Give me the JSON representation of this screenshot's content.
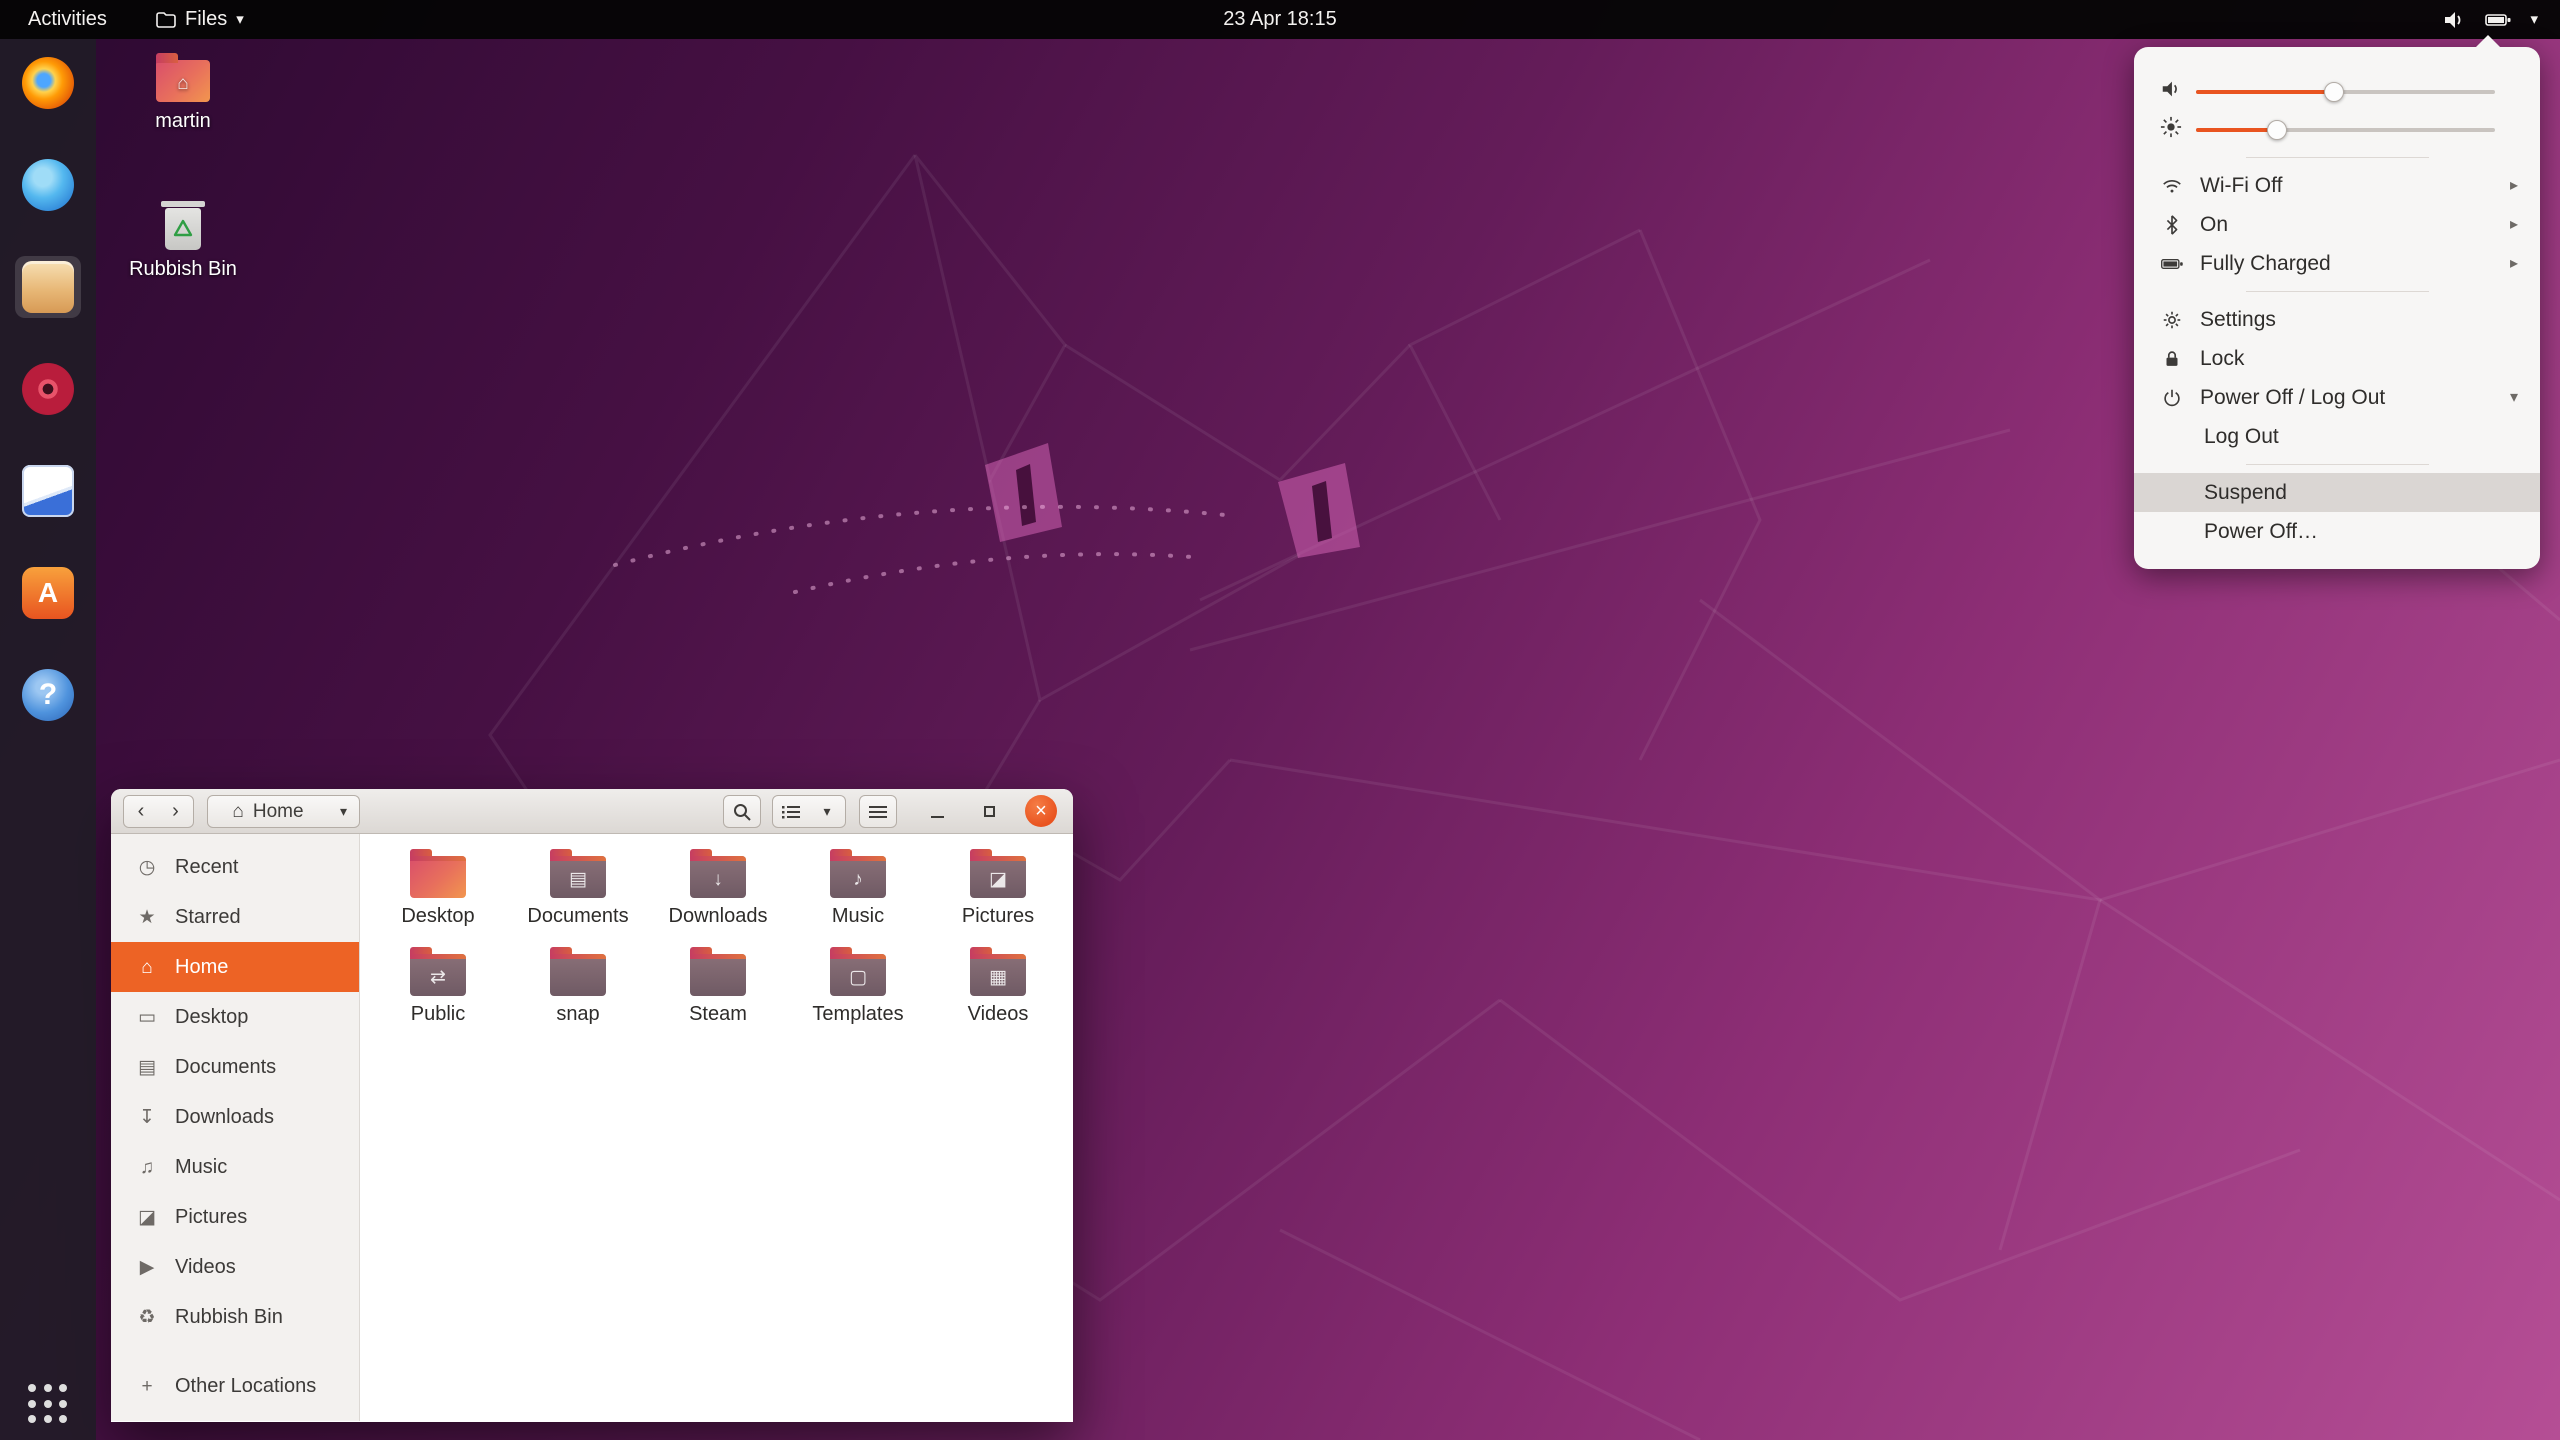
{
  "top_bar": {
    "activities_label": "Activities",
    "app_menu_label": "Files",
    "clock": "23 Apr 18:15"
  },
  "icons": {
    "chevron_down": "▾",
    "chevron_right": "▸",
    "nav_back": "‹",
    "nav_forward": "›",
    "close_glyph": "×",
    "home_glyph": "⌂",
    "plus_glyph": "+",
    "help_glyph": "?",
    "software_glyph": "A"
  },
  "desktop": {
    "icons": [
      {
        "label": "martin"
      },
      {
        "label": "Rubbish Bin"
      }
    ]
  },
  "dock": {
    "items": [
      {
        "name": "firefox"
      },
      {
        "name": "thunderbird"
      },
      {
        "name": "files",
        "active": true
      },
      {
        "name": "rhythmbox"
      },
      {
        "name": "libreoffice-writer"
      },
      {
        "name": "ubuntu-software"
      },
      {
        "name": "help"
      },
      {
        "name": "show-applications"
      }
    ]
  },
  "system_menu": {
    "volume_percent": 46,
    "brightness_percent": 27,
    "items": [
      {
        "label": "Wi-Fi Off",
        "submenu": true
      },
      {
        "label": "On",
        "submenu": true
      },
      {
        "label": "Fully Charged",
        "submenu": true
      },
      {
        "label": "Settings"
      },
      {
        "label": "Lock"
      },
      {
        "label": "Power Off / Log Out",
        "expanded": true
      },
      {
        "label": "Log Out"
      },
      {
        "label": "Suspend",
        "highlighted": true
      },
      {
        "label": "Power Off…"
      }
    ]
  },
  "file_manager": {
    "toolbar": {
      "location": "Home"
    },
    "sidebar": {
      "items": [
        {
          "label": "Recent",
          "icon": "◷"
        },
        {
          "label": "Starred",
          "icon": "★"
        },
        {
          "label": "Home",
          "icon": "⌂",
          "active": true
        },
        {
          "label": "Desktop",
          "icon": "▭"
        },
        {
          "label": "Documents",
          "icon": "▤"
        },
        {
          "label": "Downloads",
          "icon": "↧"
        },
        {
          "label": "Music",
          "icon": "♫"
        },
        {
          "label": "Pictures",
          "icon": "◪"
        },
        {
          "label": "Videos",
          "icon": "▶"
        },
        {
          "label": "Rubbish Bin",
          "icon": "♻"
        },
        {
          "label": "Other Locations",
          "icon": "+"
        }
      ]
    },
    "folders": [
      {
        "label": "Desktop",
        "emblem": "",
        "variant": "gradient"
      },
      {
        "label": "Documents",
        "emblem": "▤"
      },
      {
        "label": "Downloads",
        "emblem": "↓"
      },
      {
        "label": "Music",
        "emblem": "♪"
      },
      {
        "label": "Pictures",
        "emblem": "◪"
      },
      {
        "label": "Public",
        "emblem": "⇄"
      },
      {
        "label": "snap",
        "emblem": ""
      },
      {
        "label": "Steam",
        "emblem": ""
      },
      {
        "label": "Templates",
        "emblem": "▢"
      },
      {
        "label": "Videos",
        "emblem": "▦"
      }
    ]
  },
  "colors": {
    "accent_orange": "#E95420",
    "selection_orange": "#ED6325",
    "panel_black": "#050505",
    "menu_bg": "#f7f6f5",
    "suspend_highlight": "#dad6d3"
  }
}
